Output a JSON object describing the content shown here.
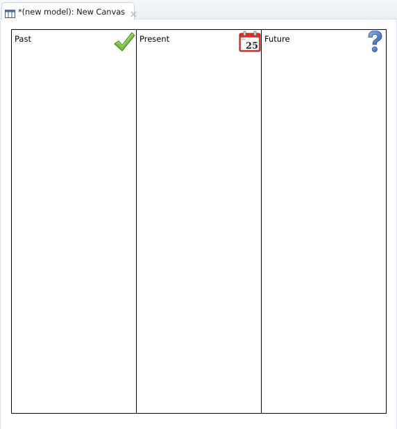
{
  "tab": {
    "title": "*(new model): New Canvas",
    "icon": "canvas-icon",
    "close_icon": "close-icon"
  },
  "canvas": {
    "columns": [
      {
        "label": "Past",
        "icon": "checkmark-icon"
      },
      {
        "label": "Present",
        "icon": "calendar-icon",
        "calendar_day": "25"
      },
      {
        "label": "Future",
        "icon": "question-mark-icon"
      }
    ]
  },
  "colors": {
    "check_green": "#7cc044",
    "calendar_red": "#d7322d",
    "help_blue": "#3b6fc4"
  }
}
